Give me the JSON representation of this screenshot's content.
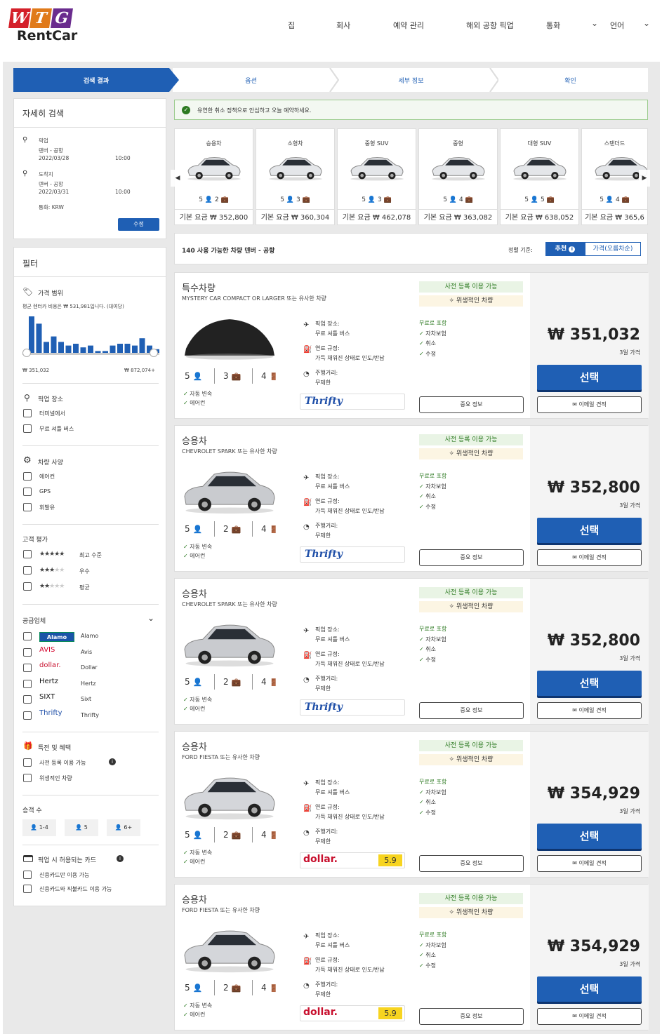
{
  "header": {
    "logo_letters": [
      "W",
      "T",
      "G"
    ],
    "logo_text": "RentCar",
    "nav": [
      "집",
      "회사",
      "예약 관리",
      "해외 공항 픽업",
      "통화",
      "언어"
    ]
  },
  "steps": [
    "검색 결과",
    "옵션",
    "세부 정보",
    "확인"
  ],
  "search": {
    "title": "자세히 검색",
    "pickup_label": "픽업",
    "pickup_location": "덴버 - 공항",
    "pickup_date": "2022/03/28",
    "pickup_time": "10:00",
    "dropoff_label": "도착지",
    "dropoff_location": "덴버 - 공항",
    "dropoff_date": "2022/03/31",
    "dropoff_time": "10:00",
    "currency": "통화: KRW",
    "modify_button": "수정"
  },
  "filters": {
    "title": "필터",
    "price_range_title": "가격 범위",
    "price_avg": "평균 렌터카 비용은 ₩ 531,981입니다. (대여당)",
    "price_min": "₩ 351,032",
    "price_max": "₩ 872,074+",
    "histogram": [
      20,
      16,
      6,
      9,
      6,
      4,
      5,
      3,
      4,
      1,
      1,
      4,
      5,
      5,
      4,
      8,
      4,
      2
    ],
    "pickup_title": "픽업 장소",
    "pickup_options": [
      "터미널에서",
      "무료 셔틀 버스"
    ],
    "spec_title": "차량 사양",
    "spec_options": [
      "에어컨",
      "GPS",
      "휘발유"
    ],
    "rating_title": "고객 평가",
    "ratings": [
      {
        "stars": 5,
        "label": "최고 수준"
      },
      {
        "stars": 3,
        "label": "우수"
      },
      {
        "stars": 2,
        "label": "평균"
      }
    ],
    "supplier_title": "공급업체",
    "suppliers": [
      {
        "logo": "Alamo",
        "name": "Alamo",
        "color": "#1a54a8"
      },
      {
        "logo": "AVIS",
        "name": "Avis",
        "color": "#d4002a"
      },
      {
        "logo": "dollar.",
        "name": "Dollar",
        "color": "#c8102e"
      },
      {
        "logo": "Hertz",
        "name": "Hertz",
        "color": "#111111"
      },
      {
        "logo": "SIXT",
        "name": "Sixt",
        "color": "#111111"
      },
      {
        "logo": "Thrifty",
        "name": "Thrifty",
        "color": "#1f4fa8"
      }
    ],
    "perks_title": "특전 및 혜택",
    "perks_options": [
      "사전 등록 이용 가능",
      "위생적인 차량"
    ],
    "passenger_title": "승객 수",
    "passenger_options": [
      "1-4",
      "5",
      "6+"
    ],
    "card_title": "픽업 시 허용되는 카드",
    "card_options": [
      "신용카드만 이용 가능",
      "신용카드와 직불카드 이용 가능"
    ]
  },
  "notice": "유연한 취소 정책으로 안심하고 오늘 예약하세요.",
  "categories": [
    {
      "name": "승용차",
      "seats": "5",
      "bags": "2",
      "price": "기본 요금 ₩ 352,800"
    },
    {
      "name": "소형차",
      "seats": "5",
      "bags": "3",
      "price": "기본 요금 ₩ 360,304"
    },
    {
      "name": "중형 SUV",
      "seats": "5",
      "bags": "3",
      "price": "기본 요금 ₩ 462,078"
    },
    {
      "name": "중형",
      "seats": "5",
      "bags": "4",
      "price": "기본 요금 ₩ 363,082"
    },
    {
      "name": "대형 SUV",
      "seats": "5",
      "bags": "5",
      "price": "기본 요금 ₩ 638,052"
    },
    {
      "name": "스탠더드",
      "seats": "5",
      "bags": "4",
      "price": "기본 요금 ₩ 365,6"
    }
  ],
  "results_bar": {
    "count_text": "140 사용 가능한 차량 덴버 - 공항",
    "sort_label": "정렬 기준:",
    "sort_recommended": "추천",
    "sort_price": "가격(오름차순)"
  },
  "common": {
    "badge_checkin": "사전 등록 이용 가능",
    "badge_clean": "위생적인 차량",
    "pickup_place_label": "픽업 장소:",
    "pickup_place_value": "무료 셔틀 버스",
    "fuel_label": "연료 규정:",
    "fuel_value": "가득 채워진 상태로 인도/반납",
    "mileage_label": "주행거리:",
    "mileage_value": "무제한",
    "included_title": "무료로 포함",
    "included": [
      "자차보험",
      "취소",
      "수정"
    ],
    "days_text": "3일 가격",
    "select_button": "선택",
    "info_button": "중요 정보",
    "email_button": "이메일 견적",
    "features": [
      "자동 변속",
      "에어컨"
    ]
  },
  "cars": [
    {
      "title": "특수차량",
      "subtitle": "MYSTERY CAR COMPACT OR LARGER 또는 유사한 차량",
      "seats": "5",
      "bags": "3",
      "doors": "4",
      "price": "₩ 351,032",
      "vendor": "Thrifty",
      "vendor_color": "#1f4fa8",
      "rating": "",
      "color": "#222222"
    },
    {
      "title": "승용차",
      "subtitle": "CHEVROLET SPARK 또는 유사한 차량",
      "seats": "5",
      "bags": "2",
      "doors": "4",
      "price": "₩ 352,800",
      "vendor": "Thrifty",
      "vendor_color": "#1f4fa8",
      "rating": "",
      "color": "#c9cbcf"
    },
    {
      "title": "승용차",
      "subtitle": "CHEVROLET SPARK 또는 유사한 차량",
      "seats": "5",
      "bags": "2",
      "doors": "4",
      "price": "₩ 352,800",
      "vendor": "Thrifty",
      "vendor_color": "#1f4fa8",
      "rating": "",
      "color": "#c9cbcf"
    },
    {
      "title": "승용차",
      "subtitle": "FORD FIESTA 또는 유사한 차량",
      "seats": "5",
      "bags": "2",
      "doors": "4",
      "price": "₩ 354,929",
      "vendor": "dollar.",
      "vendor_color": "#c8102e",
      "rating": "5.9",
      "color": "#d4d6da"
    },
    {
      "title": "승용차",
      "subtitle": "FORD FIESTA 또는 유사한 차량",
      "seats": "5",
      "bags": "2",
      "doors": "4",
      "price": "₩ 354,929",
      "vendor": "dollar.",
      "vendor_color": "#c8102e",
      "rating": "5.9",
      "color": "#d4d6da"
    }
  ],
  "colors": {
    "primary": "#1f5fb4",
    "green": "#2d7a22"
  }
}
